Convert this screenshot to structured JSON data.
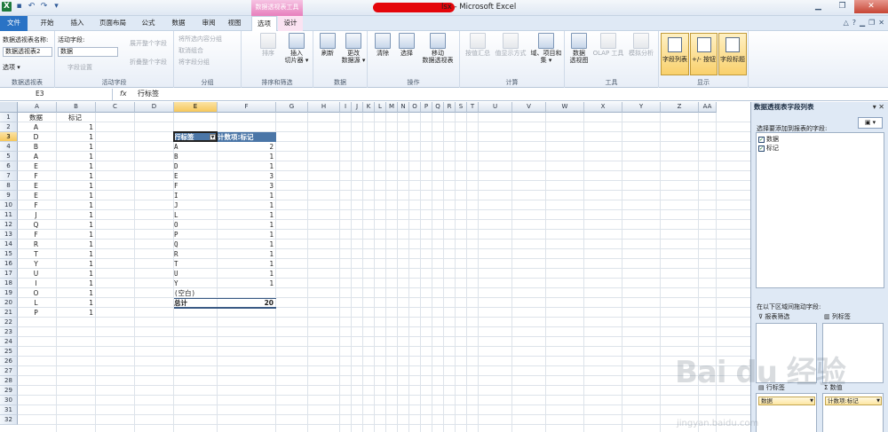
{
  "window": {
    "title_suffix": "lsx - Microsoft Excel",
    "context_tab_group": "数据透视表工具",
    "quick_access": [
      "excel-logo",
      "save-icon",
      "undo-icon",
      "redo-icon",
      "customize-icon"
    ]
  },
  "tabs": [
    {
      "label": "文件"
    },
    {
      "label": "开始"
    },
    {
      "label": "插入"
    },
    {
      "label": "页面布局"
    },
    {
      "label": "公式"
    },
    {
      "label": "数据"
    },
    {
      "label": "审阅"
    },
    {
      "label": "视图"
    },
    {
      "label": "选项"
    },
    {
      "label": "设计"
    }
  ],
  "ribbon": {
    "pivot_name_label": "数据透视表名称:",
    "pivot_name_value": "数据透视表2",
    "options_btn": "选项 ▾",
    "group_pivot": "数据透视表",
    "active_field_label": "活动字段:",
    "active_field_value": "数据",
    "field_settings": "字段设置",
    "expand_field": "展开整个字段",
    "collapse_field": "折叠整个字段",
    "group_active_field": "活动字段",
    "group_selection": "将所选内容分组",
    "ungroup": "取消组合",
    "group_field": "将字段分组",
    "group_group": "分组",
    "sort": "排序",
    "insert_slicer": "插入\n切片器 ▾",
    "group_sort_filter": "排序和筛选",
    "refresh": "刷新",
    "change_source": "更改\n数据源 ▾",
    "group_data": "数据",
    "clear": "清除",
    "select": "选择",
    "move_pivot": "移动\n数据透视表",
    "group_actions": "操作",
    "summarize_by": "按值汇总",
    "show_values_as": "值显示方式",
    "fields_items": "域、项目和\n集 ▾",
    "group_calc": "计算",
    "pivot_chart": "数据\n透视图",
    "olap_tools": "OLAP 工具",
    "what_if": "模拟分析",
    "group_tools": "工具",
    "field_list": "字段列表",
    "buttons": "+/- 按钮",
    "field_headers": "字段标题",
    "group_show": "显示"
  },
  "formula_bar": {
    "name_box": "E3",
    "fx": "fx",
    "content": "行标签"
  },
  "columns": [
    "A",
    "B",
    "C",
    "D",
    "E",
    "F",
    "G",
    "H",
    "I",
    "J",
    "K",
    "L",
    "M",
    "N",
    "O",
    "P",
    "Q",
    "R",
    "S",
    "T",
    "U",
    "V",
    "W",
    "X",
    "Y",
    "Z",
    "AA"
  ],
  "rows": [
    "1",
    "2",
    "3",
    "4",
    "5",
    "6",
    "7",
    "8",
    "9",
    "10",
    "11",
    "12",
    "13",
    "14",
    "15",
    "16",
    "17",
    "18",
    "19",
    "20",
    "21",
    "22",
    "23",
    "24",
    "25",
    "26",
    "27",
    "28",
    "29",
    "30",
    "31",
    "32"
  ],
  "source_headers": {
    "a": "数据",
    "b": "标记"
  },
  "source_data": [
    [
      "A",
      "1"
    ],
    [
      "D",
      "1"
    ],
    [
      "B",
      "1"
    ],
    [
      "A",
      "1"
    ],
    [
      "E",
      "1"
    ],
    [
      "F",
      "1"
    ],
    [
      "E",
      "1"
    ],
    [
      "E",
      "1"
    ],
    [
      "F",
      "1"
    ],
    [
      "J",
      "1"
    ],
    [
      "Q",
      "1"
    ],
    [
      "F",
      "1"
    ],
    [
      "R",
      "1"
    ],
    [
      "T",
      "1"
    ],
    [
      "Y",
      "1"
    ],
    [
      "U",
      "1"
    ],
    [
      "I",
      "1"
    ],
    [
      "O",
      "1"
    ],
    [
      "L",
      "1"
    ],
    [
      "P",
      "1"
    ]
  ],
  "pivot": {
    "row_header": "行标签",
    "value_header": "计数项:标记",
    "rows": [
      [
        "A",
        "2"
      ],
      [
        "B",
        "1"
      ],
      [
        "D",
        "1"
      ],
      [
        "E",
        "3"
      ],
      [
        "F",
        "3"
      ],
      [
        "I",
        "1"
      ],
      [
        "J",
        "1"
      ],
      [
        "L",
        "1"
      ],
      [
        "O",
        "1"
      ],
      [
        "P",
        "1"
      ],
      [
        "Q",
        "1"
      ],
      [
        "R",
        "1"
      ],
      [
        "T",
        "1"
      ],
      [
        "U",
        "1"
      ],
      [
        "Y",
        "1"
      ],
      [
        "(空白)",
        ""
      ]
    ],
    "total_label": "总计",
    "total_value": "20"
  },
  "pane": {
    "title": "数据透视表字段列表",
    "choose_fields": "选择要添加到报表的字段:",
    "fields": [
      {
        "label": "数据",
        "checked": "✓"
      },
      {
        "label": "标记",
        "checked": "✓"
      }
    ],
    "drag_hint": "在以下区域间拖动字段:",
    "report_filter": "报表筛选",
    "column_labels": "列标签",
    "row_labels": "行标签",
    "values": "数值",
    "row_chip": "数据",
    "value_chip": "计数项:标记"
  },
  "watermark": {
    "text": "Bai du 经验",
    "url": "jingyan.baidu.com"
  }
}
